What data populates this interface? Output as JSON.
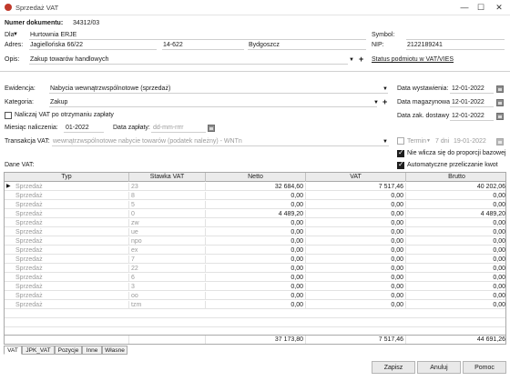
{
  "window": {
    "title": "Sprzedaż VAT",
    "minimize": "—",
    "maximize": "☐",
    "close": "✕"
  },
  "header": {
    "doc_number_label": "Numer dokumentu:",
    "doc_number_value": "34312/03",
    "dla_label": "Dla",
    "dla_value": "Hurtownia ERJE",
    "symbol_label": "Symbol:",
    "symbol_value": "",
    "adres_label": "Adres:",
    "street": "Jagiellońska  66/22",
    "postal": "14-622",
    "city": "Bydgoszcz",
    "nip_label": "NIP:",
    "nip_value": "2122189241",
    "opis_label": "Opis:",
    "opis_value": "Zakup towarów handlowych",
    "status_link": "Status podmiotu w VAT/VIES"
  },
  "details": {
    "ewidencja_label": "Ewidencja:",
    "ewidencja_value": "Nabycia wewnątrzwspólnotowe (sprzedaż)",
    "kategoria_label": "Kategoria:",
    "kategoria_value": "Zakup",
    "naliczaj_label": "Naliczaj VAT po otrzymaniu zapłaty",
    "miesiac_label": "Miesiąc naliczenia:",
    "miesiac_value": "01-2022",
    "data_zaplaty_label": "Data zapłaty:",
    "data_zaplaty_placeholder": "dd-mm-rrrr",
    "transakcja_label": "Transakcja VAT:",
    "transakcja_value": "wewnątrzwspólnotowe nabycie towarów (podatek należny) - WNTn",
    "data_wyst_label": "Data wystawienia:",
    "data_wyst_value": "12-01-2022",
    "data_mag_label": "Data magazynowa:",
    "data_mag_value": "12-01-2022",
    "data_zak_label": "Data zak. dostawy:",
    "data_zak_value": "12-01-2022",
    "termin_label": "Termin",
    "termin_days": "7 dni",
    "termin_date": "19-01-2022",
    "nie_wlicza_label": "Nie wlicza się do proporcji bazowej",
    "auto_label": "Automatyczne przeliczanie kwot",
    "dane_vat_label": "Dane VAT:"
  },
  "table": {
    "columns": [
      "Typ",
      "Stawka VAT",
      "Netto",
      "VAT",
      "Brutto"
    ],
    "rows": [
      [
        "Sprzedaż",
        "23",
        "32 684,60",
        "7 517,46",
        "40 202,06"
      ],
      [
        "Sprzedaż",
        "8",
        "0,00",
        "0,00",
        "0,00"
      ],
      [
        "Sprzedaż",
        "5",
        "0,00",
        "0,00",
        "0,00"
      ],
      [
        "Sprzedaż",
        "0",
        "4 489,20",
        "0,00",
        "4 489,20"
      ],
      [
        "Sprzedaż",
        "zw",
        "0,00",
        "0,00",
        "0,00"
      ],
      [
        "Sprzedaż",
        "ue",
        "0,00",
        "0,00",
        "0,00"
      ],
      [
        "Sprzedaż",
        "npo",
        "0,00",
        "0,00",
        "0,00"
      ],
      [
        "Sprzedaż",
        "ex",
        "0,00",
        "0,00",
        "0,00"
      ],
      [
        "Sprzedaż",
        "7",
        "0,00",
        "0,00",
        "0,00"
      ],
      [
        "Sprzedaż",
        "22",
        "0,00",
        "0,00",
        "0,00"
      ],
      [
        "Sprzedaż",
        "6",
        "0,00",
        "0,00",
        "0,00"
      ],
      [
        "Sprzedaż",
        "3",
        "0,00",
        "0,00",
        "0,00"
      ],
      [
        "Sprzedaż",
        "oo",
        "0,00",
        "0,00",
        "0,00"
      ],
      [
        "Sprzedaż",
        "tzm",
        "0,00",
        "0,00",
        "0,00"
      ]
    ],
    "totals": [
      "37 173,80",
      "7 517,46",
      "44 691,26"
    ]
  },
  "tabs": [
    "VAT",
    "JPK_VAT",
    "Pozycje",
    "Inne",
    "Własne"
  ],
  "buttons": {
    "save": "Zapisz",
    "cancel": "Anuluj",
    "help": "Pomoc"
  }
}
